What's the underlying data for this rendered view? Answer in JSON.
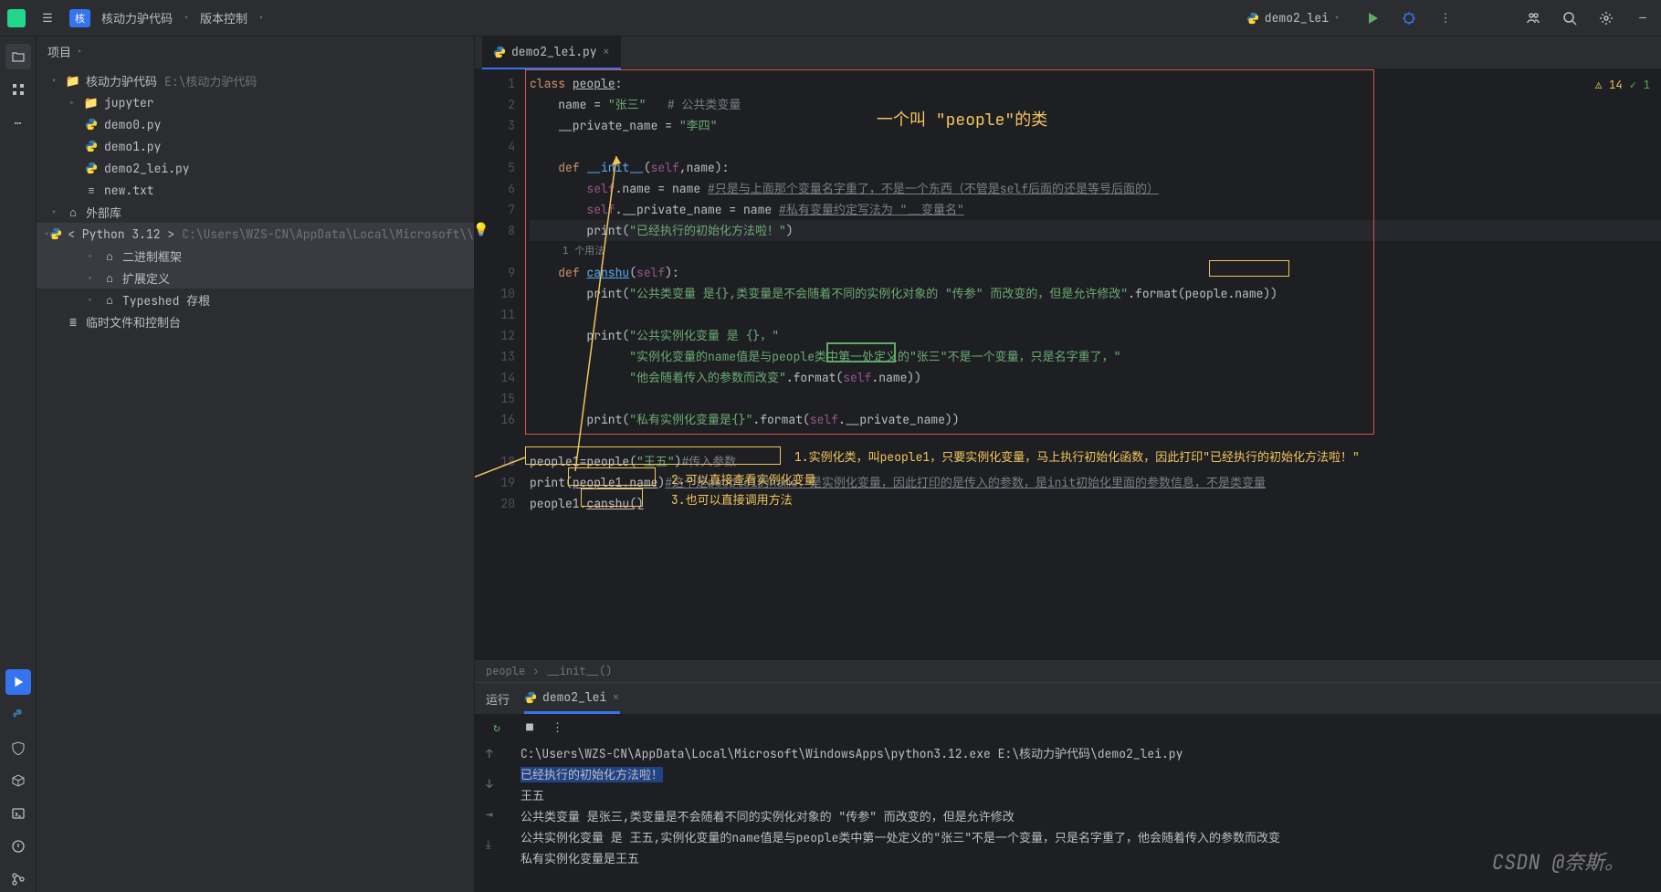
{
  "titlebar": {
    "project_badge": "核",
    "project_name": "核动力驴代码",
    "vcs_label": "版本控制",
    "run_config": "demo2_lei"
  },
  "sidebar": {
    "header": "项目",
    "tree": {
      "root_name": "核动力驴代码",
      "root_path": "E:\\核动力驴代码",
      "jupyter": "jupyter",
      "demo0": "demo0.py",
      "demo1": "demo1.py",
      "demo2": "demo2_lei.py",
      "newtxt": "new.txt",
      "ext_libs": "外部库",
      "python": "< Python 3.12 >",
      "python_path": "C:\\Users\\WZS-CN\\AppData\\Local\\Microsoft\\\\",
      "binary": "二进制框架",
      "extdef": "扩展定义",
      "typeshed": "Typeshed 存根",
      "scratch": "临时文件和控制台"
    }
  },
  "tabs": {
    "active": "demo2_lei.py"
  },
  "gutter": [
    "1",
    "2",
    "3",
    "4",
    "5",
    "6",
    "7",
    "8",
    "",
    "9",
    "10",
    "11",
    "12",
    "13",
    "14",
    "15",
    "16",
    "",
    "18",
    "19",
    "20"
  ],
  "code": {
    "l1": {
      "a": "class ",
      "b": "people",
      "c": ":"
    },
    "l2": {
      "a": "    name = ",
      "b": "\"张三\"",
      "c": "   # 公共类变量"
    },
    "l3": {
      "a": "    __private_name = ",
      "b": "\"李四\""
    },
    "l5": {
      "a": "    ",
      "b": "def ",
      "c": "__init__",
      "d": "(",
      "e": "self",
      "f": ",name):"
    },
    "l6": {
      "a": "        ",
      "b": "self",
      "c": ".name = name ",
      "d": "#只是与上面那个变量名字重了，不是一个东西（不管是self后面的还是等号后面的）"
    },
    "l7": {
      "a": "        ",
      "b": "self",
      "c": ".__private_name = name ",
      "d": "#私有变量约定写法为 \"__变量名\""
    },
    "l8": {
      "a": "        print(",
      "b": "\"已经执行的初始化方法啦！\"",
      "c": ")"
    },
    "usage": "1 个用法",
    "l9": {
      "a": "    ",
      "b": "def ",
      "c": "canshu",
      "d": "(",
      "e": "self",
      "f": "):"
    },
    "l10": {
      "a": "        print(",
      "b": "\"公共类变量 是{},类变量是不会随着不同的实例化对象的 \"传参\" 而改变的，但是允许修改\"",
      "c": ".format(",
      "d": "people",
      "e": ".name))"
    },
    "l12": {
      "a": "        print(",
      "b": "\"公共实例化变量 是 {}，\""
    },
    "l13": {
      "a": "              ",
      "b": "\"实例化变量的name值是与people类中第一处定义的\"张三\"不是一个变量，只是名字重了，\""
    },
    "l14": {
      "a": "              ",
      "b": "\"他会随着传入的参数而改变\"",
      "c": ".format(",
      "d": "self",
      "e": ".name))"
    },
    "l16": {
      "a": "        print(",
      "b": "\"私有实例化变量是{}\"",
      "c": ".format(",
      "d": "self",
      "e": ".__private_name))"
    },
    "l18": {
      "a": "people1=people(",
      "b": "\"王五\"",
      "c": ")",
      "d": "#传入参数"
    },
    "l19": {
      "a": "print(",
      "b": "people1.name",
      "c": ")",
      "d": "#这个是people1的name，是实例化变量，因此打印的是传入的参数，是init初始化里面的参数信息，不是类变量"
    },
    "l20": {
      "a": "people1.",
      "b": "canshu()"
    }
  },
  "annotations": {
    "title": "一个叫 \"people\"的类",
    "a1": "1.实例化类，叫people1，只要实例化变量，马上执行初始化函数，因此打印\"已经执行的初始化方法啦！\"",
    "a2": "2.可以直接查看实例化变量",
    "a3": "3.也可以直接调用方法"
  },
  "inspections": {
    "warn": "14",
    "ok": "1"
  },
  "breadcrumb": {
    "a": "people",
    "b": "__init__()"
  },
  "run": {
    "label": "运行",
    "tab": "demo2_lei",
    "out1": "C:\\Users\\WZS-CN\\AppData\\Local\\Microsoft\\WindowsApps\\python3.12.exe E:\\核动力驴代码\\demo2_lei.py",
    "out2": "已经执行的初始化方法啦！",
    "out3": "王五",
    "out4": "公共类变量 是张三,类变量是不会随着不同的实例化对象的 \"传参\" 而改变的，但是允许修改",
    "out5": "公共实例化变量 是 王五,实例化变量的name值是与people类中第一处定义的\"张三\"不是一个变量，只是名字重了，他会随着传入的参数而改变",
    "out6": "私有实例化变量是王五"
  },
  "watermark": "CSDN @奈斯。"
}
